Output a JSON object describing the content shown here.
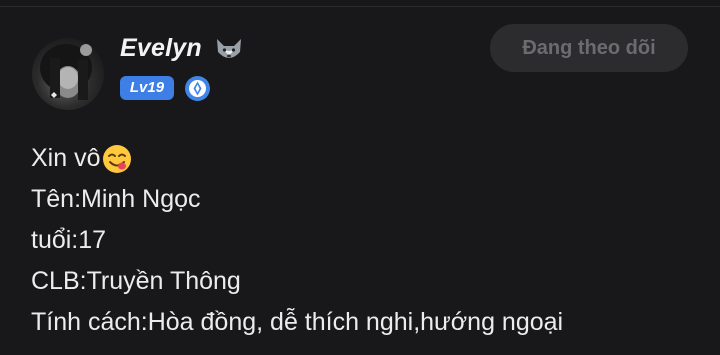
{
  "profile": {
    "username": "Evelyn",
    "level": "Lv19",
    "follow_button": "Đang theo dõi",
    "icons": {
      "name_emoji": "wolf-icon",
      "verified": "verified-badge-icon",
      "bio_emoji": "yum-face-icon"
    },
    "colors": {
      "level_badge": "#3d7fe6",
      "background": "#18181a",
      "follow_button_bg": "#2c2c2f"
    }
  },
  "bio": {
    "line1": "Xin vô",
    "line2": "Tên:Minh Ngọc",
    "line3": "tuổi:17",
    "line4": "CLB:Truyền Thông",
    "line5": "Tính cách:Hòa đồng, dễ thích nghi,hướng ngoại"
  }
}
